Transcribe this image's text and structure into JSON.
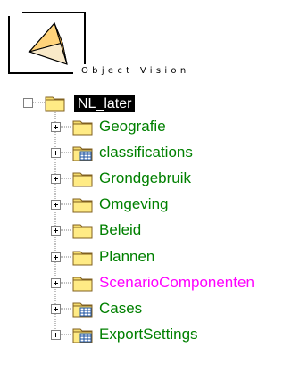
{
  "brand": {
    "name": "Object Vision"
  },
  "tree": {
    "root": {
      "label": "NL_later",
      "expanded": true,
      "icon": "folder-icon"
    },
    "children": [
      {
        "label": "Geografie",
        "color": "#008000",
        "icon": "folder-icon"
      },
      {
        "label": "classifications",
        "color": "#008000",
        "icon": "folder-table-icon"
      },
      {
        "label": "Grondgebruik",
        "color": "#008000",
        "icon": "folder-icon"
      },
      {
        "label": "Omgeving",
        "color": "#008000",
        "icon": "folder-icon"
      },
      {
        "label": "Beleid",
        "color": "#008000",
        "icon": "folder-icon"
      },
      {
        "label": "Plannen",
        "color": "#008000",
        "icon": "folder-icon"
      },
      {
        "label": "ScenarioComponenten",
        "color": "#ff00ff",
        "icon": "folder-icon"
      },
      {
        "label": "Cases",
        "color": "#008000",
        "icon": "folder-table-icon"
      },
      {
        "label": "ExportSettings",
        "color": "#008000",
        "icon": "folder-table-icon"
      }
    ]
  }
}
